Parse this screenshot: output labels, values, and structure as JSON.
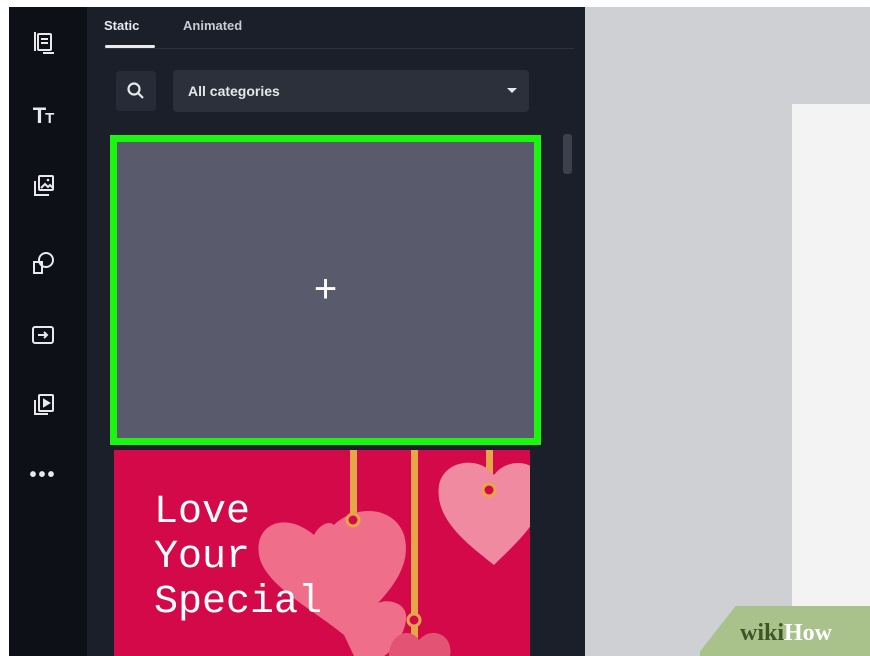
{
  "rail": {
    "items": [
      {
        "name": "templates-icon"
      },
      {
        "name": "text-icon",
        "label_big": "T",
        "label_small": "T"
      },
      {
        "name": "photos-icon"
      },
      {
        "name": "elements-icon"
      },
      {
        "name": "uploads-icon"
      },
      {
        "name": "videos-icon"
      },
      {
        "name": "more-icon",
        "label": "•••"
      }
    ]
  },
  "panel": {
    "tabs": [
      {
        "label": "Static",
        "active": true
      },
      {
        "label": "Animated",
        "active": false
      }
    ],
    "search_icon": "search-icon",
    "category_select": {
      "value": "All categories"
    },
    "create_blank": {
      "symbol": "+",
      "highlight_color": "#1cf50f"
    },
    "template": {
      "lines": [
        "Love",
        "Your",
        "Special"
      ],
      "background": "#d4094a"
    }
  },
  "watermark": {
    "part1": "wiki",
    "part2": "How"
  }
}
